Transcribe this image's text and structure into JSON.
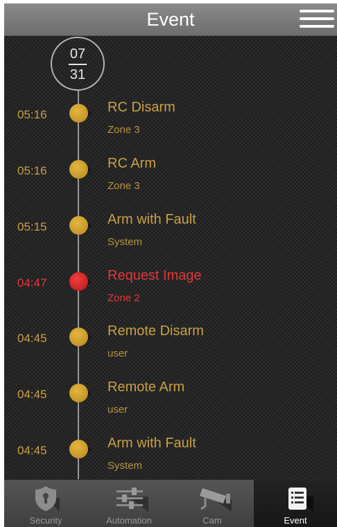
{
  "header": {
    "title": "Event"
  },
  "date": {
    "month": "07",
    "day": "31"
  },
  "events": [
    {
      "time": "05:16",
      "title": "RC Disarm",
      "source": "Zone 3"
    },
    {
      "time": "05:16",
      "title": "RC Arm",
      "source": "Zone 3"
    },
    {
      "time": "05:15",
      "title": "Arm with Fault",
      "source": "System"
    },
    {
      "time": "04:47",
      "title": "Request Image",
      "source": "Zone 2"
    },
    {
      "time": "04:45",
      "title": "Remote Disarm",
      "source": "user"
    },
    {
      "time": "04:45",
      "title": "Remote Arm",
      "source": "user"
    },
    {
      "time": "04:45",
      "title": "Arm with Fault",
      "source": "System"
    }
  ],
  "tabs": [
    {
      "label": "Security",
      "icon": "shield-keyhole-icon"
    },
    {
      "label": "Automation",
      "icon": "sliders-icon"
    },
    {
      "label": "Cam",
      "icon": "security-camera-icon"
    },
    {
      "label": "Event",
      "icon": "event-list-icon"
    }
  ],
  "colors": {
    "event": "#c9a045",
    "alert": "#e03838",
    "active_tab": "#171717"
  }
}
